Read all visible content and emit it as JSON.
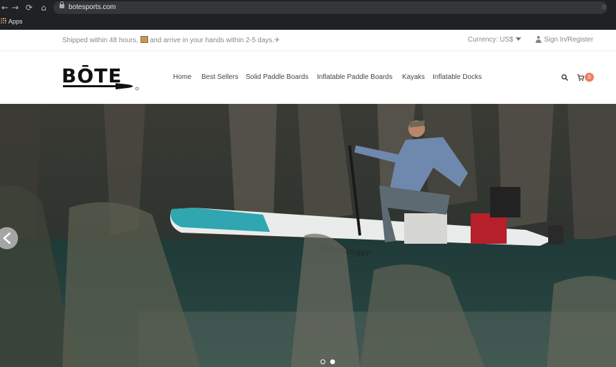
{
  "browser": {
    "url": "botesports.com",
    "bookmarks": {
      "apps_label": "Apps"
    },
    "icons": [
      "back-icon",
      "forward-icon",
      "reload-icon",
      "home-icon",
      "lock-icon",
      "apps-icon",
      "star-icon"
    ]
  },
  "topbar": {
    "shipping_text_a": "Shipped within 48 hours,",
    "shipping_text_b": "and arrive in your hands within 2-5 days.",
    "shipping_plane": "✈",
    "currency": "Currency: US$",
    "sign_in": "Sign In/Register"
  },
  "header": {
    "logo_text": "BŌTE",
    "nav": [
      "Home",
      "Best Sellers",
      "Solid Paddle Boards",
      "Inflatable Paddle Boards",
      "Kayaks",
      "Inflatable Docks"
    ],
    "cart_count": "0"
  },
  "hero": {
    "board_text": "Magslinger",
    "active_slide": 2,
    "slide_count": 2
  },
  "colors": {
    "accent": "#f0795e",
    "chrome": "#202124",
    "nav_text": "#444444",
    "muted_text": "#888888"
  }
}
